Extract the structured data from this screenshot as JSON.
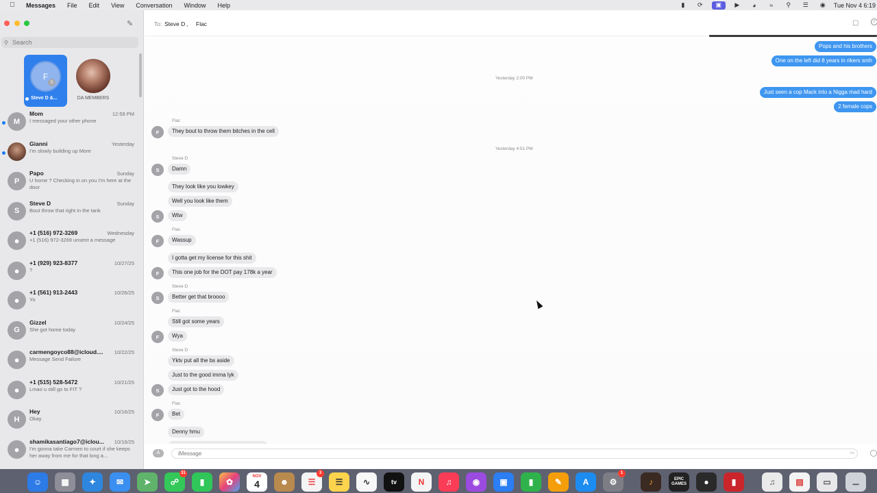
{
  "menubar": {
    "app_name": "Messages",
    "items": [
      "File",
      "Edit",
      "View",
      "Conversation",
      "Window",
      "Help"
    ],
    "clock": "Tue Nov 4  6:19"
  },
  "sidebar": {
    "search_placeholder": "Search",
    "pinned": [
      {
        "label": "Steve D &...",
        "initial": "F",
        "mini_initial": "S",
        "selected": true
      },
      {
        "label": "DA MEMBERS"
      }
    ],
    "conversations": [
      {
        "name": "Mom",
        "date": "12:59 PM",
        "preview": "I messaged your other phone",
        "initial": "M",
        "unread": true
      },
      {
        "name": "Gianni",
        "date": "Yesterday",
        "preview": "I'm slowly building up More",
        "initial": "",
        "unread": true,
        "photo": true
      },
      {
        "name": "Papo",
        "date": "Sunday",
        "preview": "U home ? Checking in on you I'm here at the door",
        "initial": "P"
      },
      {
        "name": "Steve D",
        "date": "Sunday",
        "preview": "Bout throw that right in the tank",
        "initial": "S"
      },
      {
        "name": "+1 (516) 972-3269",
        "date": "Wednesday",
        "preview": "+1 (516) 972-3269 unsent a message",
        "initial": "●"
      },
      {
        "name": "+1 (929) 923-8377",
        "date": "10/27/25",
        "preview": "?",
        "initial": "●"
      },
      {
        "name": "+1 (561) 913-2443",
        "date": "10/26/25",
        "preview": "Yo",
        "initial": "●"
      },
      {
        "name": "Gizzel",
        "date": "10/24/25",
        "preview": "She got home today",
        "initial": "G"
      },
      {
        "name": "carmengoyco88@icloud....",
        "date": "10/22/25",
        "preview": "Message Send Failure",
        "initial": "●"
      },
      {
        "name": "+1 (515) 528-5472",
        "date": "10/21/25",
        "preview": "Lmao u still go to FIT ?",
        "initial": "●"
      },
      {
        "name": "Hey",
        "date": "10/16/25",
        "preview": "Okay",
        "initial": "H"
      },
      {
        "name": "shamikasantiago7@iclou...",
        "date": "10/16/25",
        "preview": "I'm gonna take Carmen to court if she keeps her away from me for that long a...",
        "initial": "●"
      }
    ]
  },
  "chat": {
    "to_label": "To:",
    "recipients": [
      "Steve D",
      ",",
      "Flac"
    ],
    "timestamps": [
      "Yesterday 2:00 PM",
      "Yesterday 4:51 PM"
    ],
    "outgoing": [
      "Pops and his brothers",
      "One on the left did 8 years in rikers smh",
      "Just seen a cop Mack into a Nigga mad hard",
      "2 female cops"
    ],
    "senders": [
      "Flac",
      "Steve D",
      "Flac",
      "Steve D",
      "Flac",
      "Steve D",
      "Flac"
    ],
    "incoming": [
      "They bout to throw them bitches in the cell",
      "Damn",
      "They look like you lowkey",
      "Well you look like them",
      "Wtw",
      "Wassup",
      "I gotta get my license for this shit",
      "This one job for the DOT pay 178k a year",
      "Better get that broooo",
      "Still got some years",
      "Wya",
      "Yktv put all the bs aside",
      "Just to the good imma lyk",
      "Just got to the hood",
      "Bet",
      "Denny hmu"
    ],
    "input_placeholder": "iMessage"
  },
  "dock": {
    "badges": {
      "messages": "31",
      "reminders": "3",
      "settings": "1"
    },
    "calendar": {
      "month": "NOV",
      "day": "4"
    },
    "labels": {
      "epic": "EPIC GAMES",
      "tv": "tv"
    }
  },
  "colors": {
    "accent": "#2f80ed",
    "outgoing_bubble": "#3e96f0",
    "incoming_bubble": "#e9e9eb",
    "unread_dot": "#1a7cf5",
    "dock": "#5e6170"
  }
}
